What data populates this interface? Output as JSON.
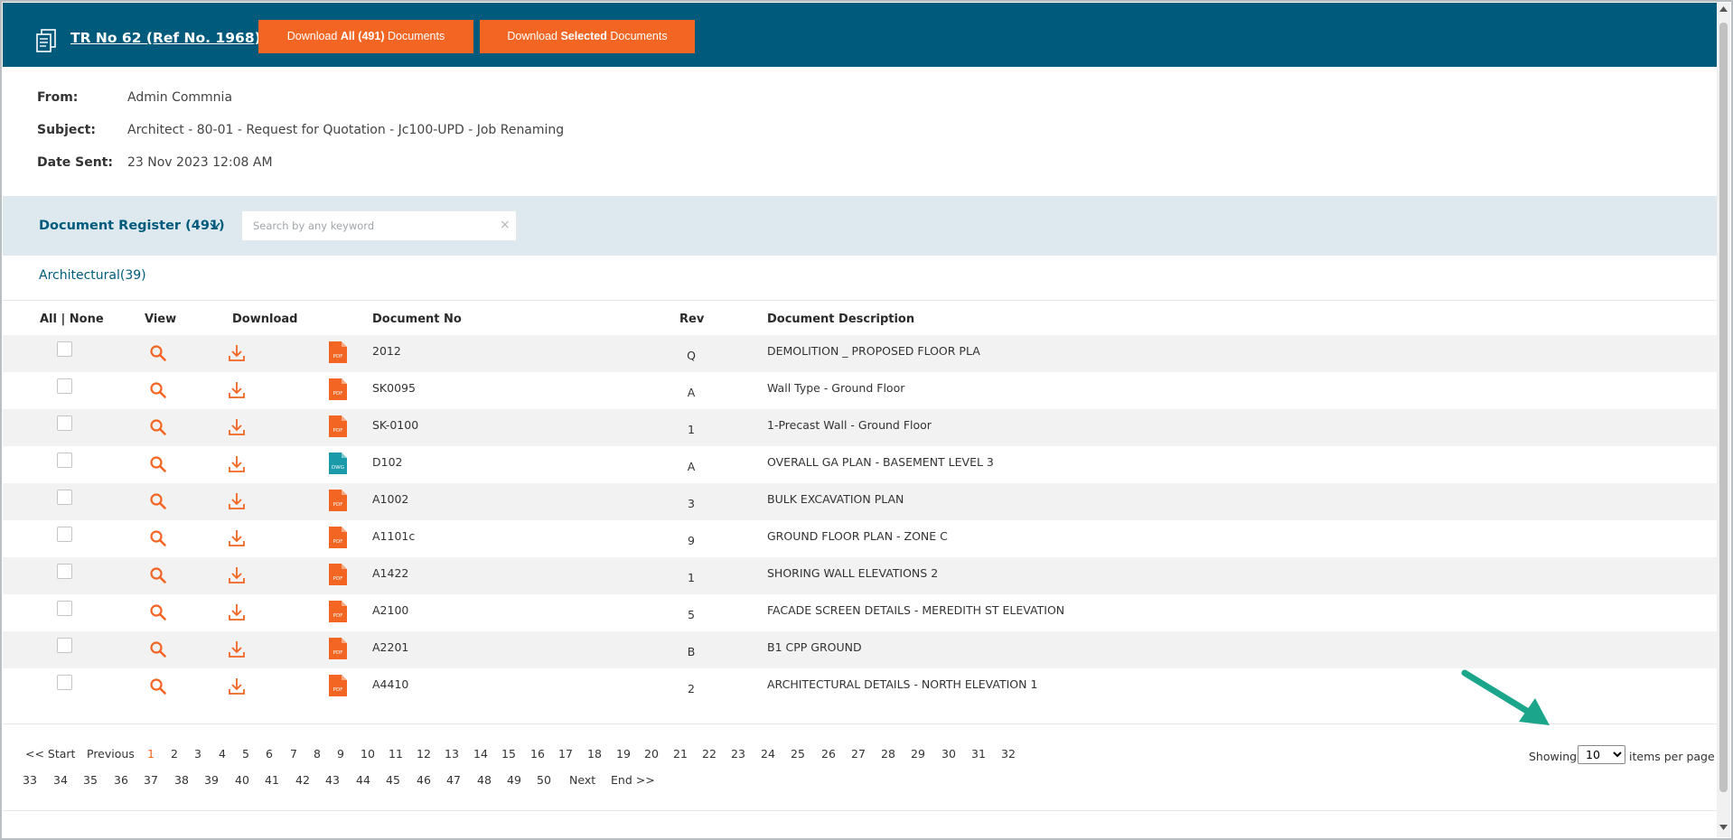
{
  "header": {
    "title": "TR No 62 (Ref No. 1968)",
    "download_all": {
      "pre": "Download ",
      "bold": "All (491)",
      "post": " Documents"
    },
    "download_selected": {
      "pre": "Download ",
      "bold": "Selected",
      "post": " Documents"
    }
  },
  "info": {
    "from_label": "From:",
    "from_value": "Admin Commnia",
    "subject_label": "Subject:",
    "subject_value": "Architect - 80-01 - Request for Quotation - Jc100-UPD - Job Renaming",
    "date_label": "Date Sent:",
    "date_value": "23 Nov 2023 12:08 AM"
  },
  "register": {
    "title": "Document Register (491)",
    "search_placeholder": "Search by any keyword",
    "clear_symbol": "×"
  },
  "category": {
    "label": "Architectural(39)"
  },
  "table": {
    "headers": {
      "select": "All | None",
      "view": "View",
      "download": "Download",
      "document_no": "Document No",
      "rev": "Rev",
      "description": "Document Description"
    },
    "rows": [
      {
        "file_type": "PDF",
        "doc_no": "2012",
        "rev": "Q",
        "desc": "DEMOLITION _ PROPOSED FLOOR PLA"
      },
      {
        "file_type": "PDF",
        "doc_no": "SK0095",
        "rev": "A",
        "desc": "Wall Type - Ground Floor"
      },
      {
        "file_type": "PDF",
        "doc_no": "SK-0100",
        "rev": "1",
        "desc": "1-Precast Wall - Ground Floor"
      },
      {
        "file_type": "DWG",
        "doc_no": "D102",
        "rev": "A",
        "desc": "OVERALL GA PLAN - BASEMENT LEVEL 3"
      },
      {
        "file_type": "PDF",
        "doc_no": "A1002",
        "rev": "3",
        "desc": "BULK EXCAVATION PLAN"
      },
      {
        "file_type": "PDF",
        "doc_no": "A1101c",
        "rev": "9",
        "desc": "GROUND FLOOR PLAN - ZONE C"
      },
      {
        "file_type": "PDF",
        "doc_no": "A1422",
        "rev": "1",
        "desc": "SHORING WALL ELEVATIONS 2"
      },
      {
        "file_type": "PDF",
        "doc_no": "A2100",
        "rev": "5",
        "desc": "FACADE SCREEN DETAILS - MEREDITH ST ELEVATION"
      },
      {
        "file_type": "PDF",
        "doc_no": "A2201",
        "rev": "B",
        "desc": "B1 CPP GROUND"
      },
      {
        "file_type": "PDF",
        "doc_no": "A4410",
        "rev": "2",
        "desc": "ARCHITECTURAL DETAILS - NORTH ELEVATION 1"
      }
    ]
  },
  "pagination": {
    "start": "<< Start",
    "previous": "Previous",
    "next": "Next",
    "end": "End >>",
    "current": "1",
    "line1": [
      "1",
      "2",
      "3",
      "4",
      "5",
      "6",
      "7",
      "8",
      "9",
      "10",
      "11",
      "12",
      "13",
      "14",
      "15",
      "16",
      "17",
      "18",
      "19",
      "20",
      "21",
      "22",
      "23",
      "24",
      "25",
      "26",
      "27",
      "28",
      "29",
      "30",
      "31",
      "32"
    ],
    "line2": [
      "33",
      "34",
      "35",
      "36",
      "37",
      "38",
      "39",
      "40",
      "41",
      "42",
      "43",
      "44",
      "45",
      "46",
      "47",
      "48",
      "49",
      "50"
    ],
    "showing_label": "Showing",
    "items_per_page_value": "10",
    "items_per_page_label": "items per page"
  },
  "colors": {
    "header_bg": "#005a7b",
    "accent": "#f26522",
    "register_bg": "#dde9ee",
    "dwg_icon": "#1b9aaa",
    "annotation_arrow": "#1ba58a"
  }
}
